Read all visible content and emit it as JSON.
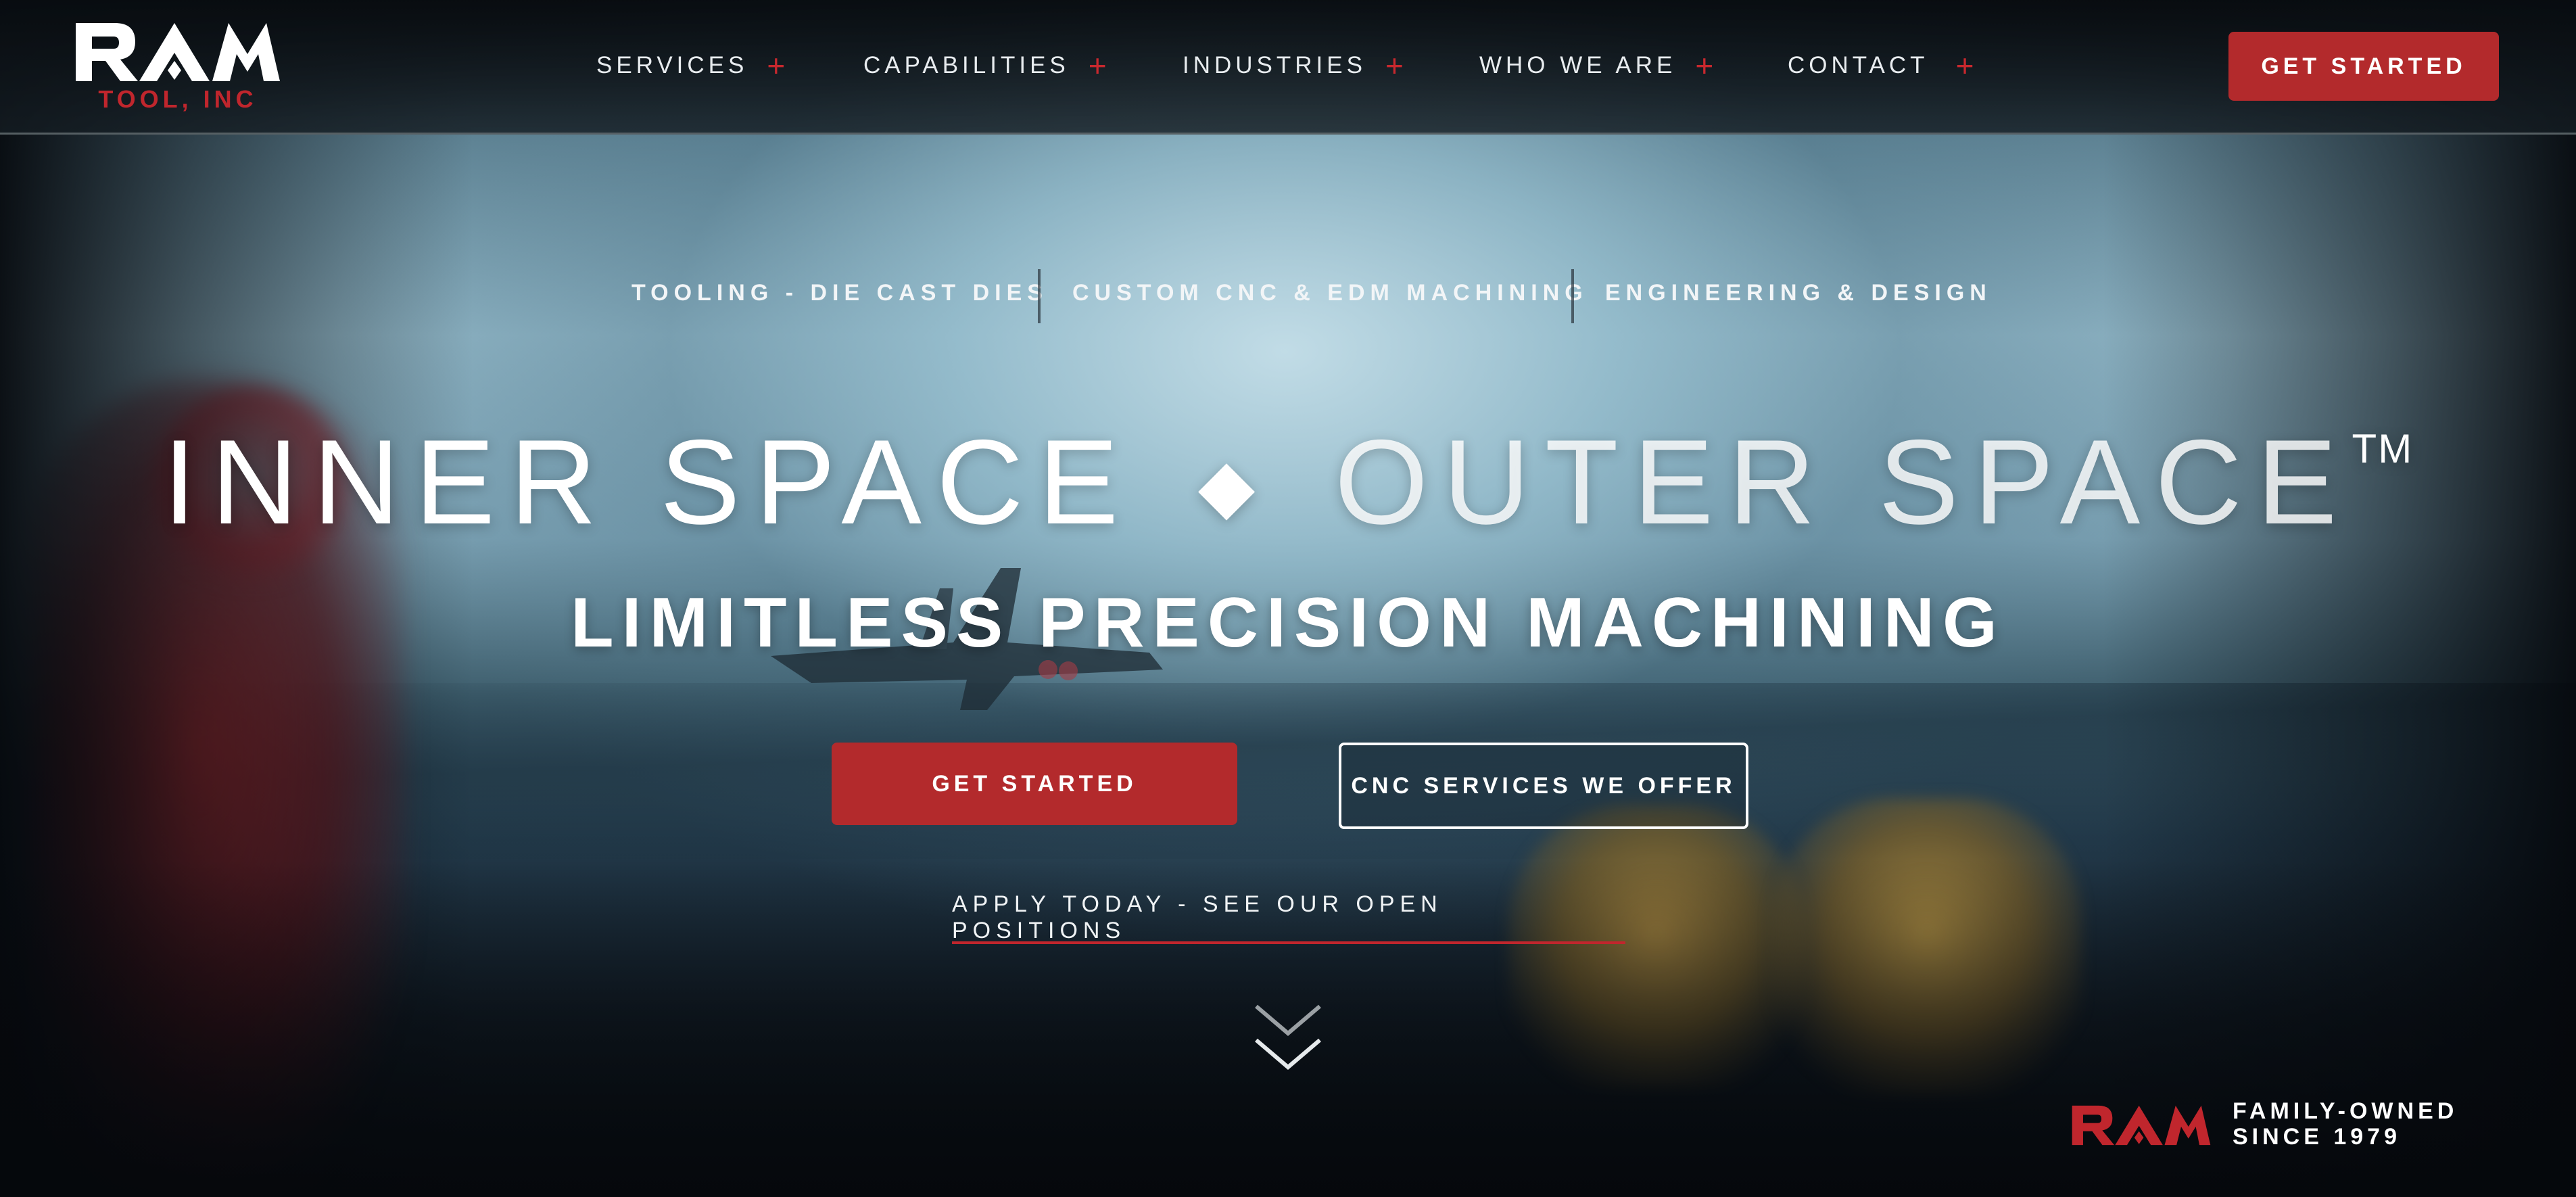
{
  "brand": {
    "logo_text": "RAM",
    "logo_subtitle": "TOOL, INC"
  },
  "nav": {
    "items": [
      {
        "label": "SERVICES",
        "icon": "plus-icon"
      },
      {
        "label": "CAPABILITIES",
        "icon": "plus-icon"
      },
      {
        "label": "INDUSTRIES",
        "icon": "plus-icon"
      },
      {
        "label": "WHO WE ARE",
        "icon": "plus-icon"
      },
      {
        "label": "CONTACT",
        "icon": "plus-icon"
      }
    ],
    "plus_glyph": "+",
    "cta_label": "GET STARTED"
  },
  "hero": {
    "taglines": [
      "TOOLING - DIE CAST DIES",
      "CUSTOM CNC & EDM MACHINING",
      "ENGINEERING & DESIGN"
    ],
    "headline_part1": "INNER SPACE",
    "headline_separator": "◆",
    "headline_part2": "OUTER SPACE",
    "headline_tm": "TM",
    "subheadline": "LIMITLESS PRECISION MACHINING",
    "primary_cta": "GET STARTED",
    "secondary_cta": "CNC SERVICES WE OFFER",
    "apply_link": "APPLY TODAY - SEE OUR OPEN POSITIONS",
    "scroll_icon": "chevron-down-double-icon"
  },
  "badge": {
    "logo_text": "RAM",
    "text": "FAMILY-OWNED\nSINCE 1979"
  },
  "colors": {
    "accent_red": "#b32a2c",
    "logo_red": "#c0262d",
    "text_white": "#ffffff"
  }
}
